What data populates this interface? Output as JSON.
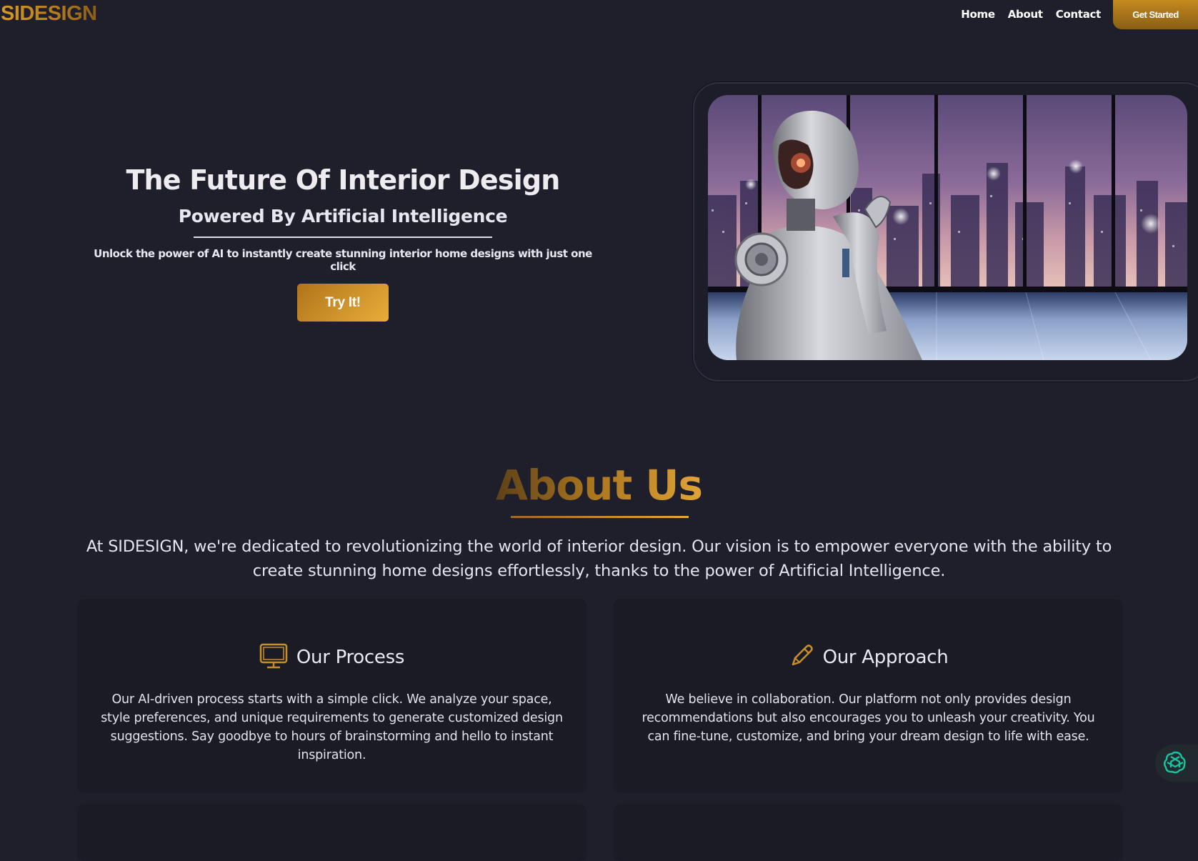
{
  "brand": {
    "logo": "SIDESIGN",
    "accent": "#d59a25",
    "background": "#1f1e2b"
  },
  "nav": {
    "links": [
      {
        "label": "Home"
      },
      {
        "label": "About"
      },
      {
        "label": "Contact"
      }
    ],
    "cta_label": "Get Started"
  },
  "hero": {
    "title": "The Future Of Interior Design",
    "subtitle": "Powered By Artificial Intelligence",
    "description": "Unlock the power of AI to instantly create stunning interior home designs with just one click",
    "button_label": "Try It!",
    "image_alt": "Humanoid robot looking at a night city skyline through large windows"
  },
  "about": {
    "title": "About Us",
    "description": "At SIDESIGN, we're dedicated to revolutionizing the world of interior design. Our vision is to empower everyone with the ability to create stunning home designs effortlessly, thanks to the power of Artificial Intelligence.",
    "cards": [
      {
        "icon": "monitor-icon",
        "title": "Our Process",
        "body": "Our AI-driven process starts with a simple click. We analyze your space, style preferences, and unique requirements to generate customized design suggestions. Say goodbye to hours of brainstorming and hello to instant inspiration."
      },
      {
        "icon": "pencil-icon",
        "title": "Our Approach",
        "body": "We believe in collaboration. Our platform not only provides design recommendations but also encourages you to unleash your creativity. You can fine-tune, customize, and bring your dream design to life with ease."
      }
    ]
  },
  "chat_widget": {
    "icon": "openai-icon"
  }
}
